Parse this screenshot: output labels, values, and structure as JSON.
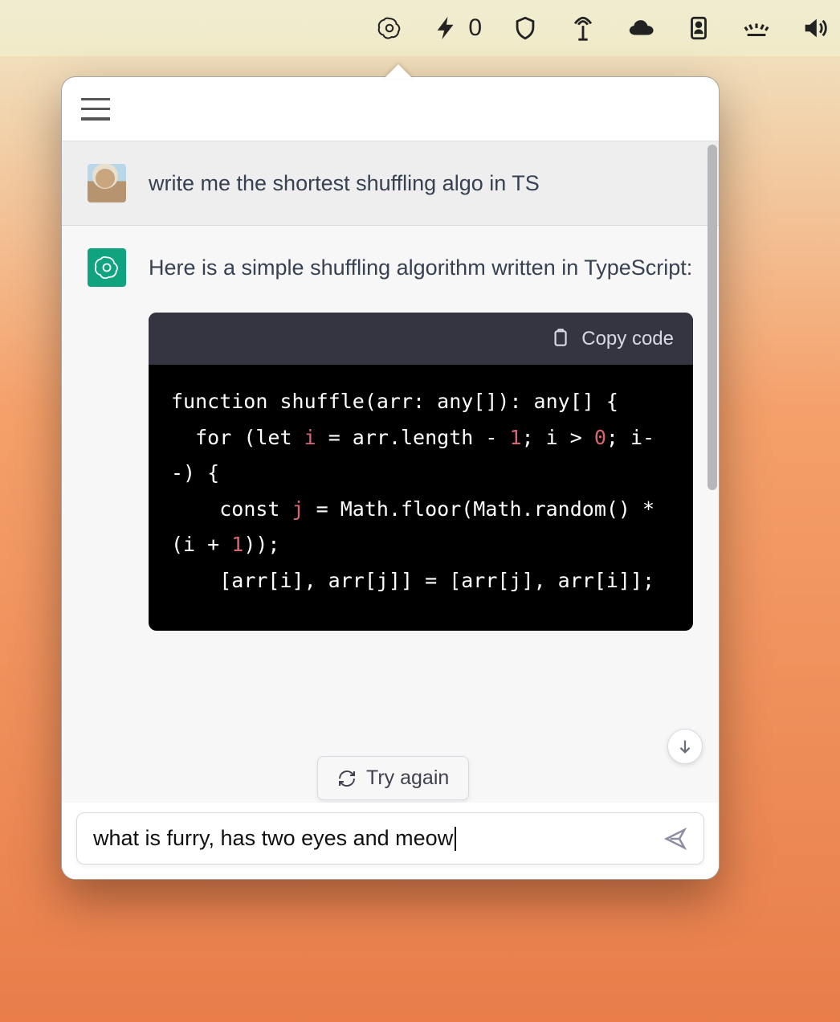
{
  "menubar": {
    "battery_count": "0"
  },
  "chat": {
    "user_message": "write me the shortest shuffling algo in TS",
    "assistant_intro": "Here is a simple shuffling algorithm written in TypeScript:",
    "copy_label": "Copy code",
    "try_again_label": "Try again",
    "code": {
      "line1_a": "function",
      "line1_b": " shuffle(arr: any[]): any[] {",
      "line2_a": "  for (let ",
      "line2_i": "i",
      "line2_b": " = arr.length - ",
      "line2_num": "1",
      "line2_c": "; i > ",
      "line3_num": "0",
      "line3_b": "; i--) {",
      "line4_a": "    const ",
      "line4_j": "j",
      "line4_b": " = Math.floor(Math.random() * (i + ",
      "line5_num": "1",
      "line5_b": "));",
      "line6_a": "    [arr[i], arr[j]] = [arr[j], arr[i]];"
    },
    "code_plain": "function shuffle(arr: any[]): any[] {\n  for (let i = arr.length - 1; i > 0; i--) {\n    const j = Math.floor(Math.random() * (i + 1));\n    [arr[i], arr[j]] = [arr[j], arr[i]];\n  }\n}"
  },
  "input": {
    "value": "what is furry, has two eyes and meow"
  }
}
